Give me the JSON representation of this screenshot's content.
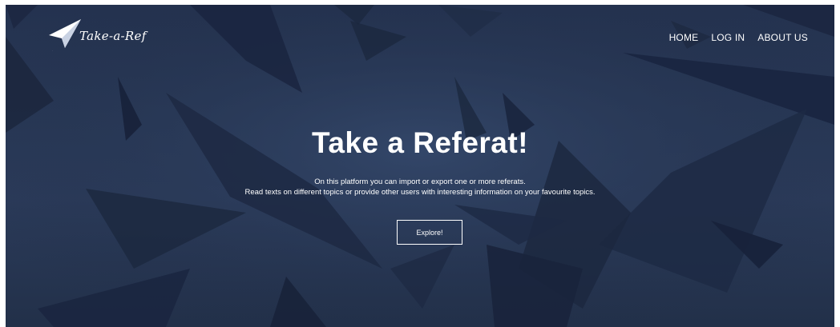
{
  "brand": {
    "name": "Take-a-Ref"
  },
  "nav": {
    "home": "HOME",
    "login": "LOG IN",
    "about": "ABOUT US"
  },
  "hero": {
    "title": "Take a Referat!",
    "line1": "On this platform you can import or export one or more referats.",
    "line2": "Read texts on different topics or provide other users with interesting information on your favourite topics.",
    "cta": "Explore!"
  },
  "colors": {
    "overlay": "#283856",
    "text": "#ffffff"
  },
  "icons": {
    "logo": "paper-plane-icon"
  }
}
